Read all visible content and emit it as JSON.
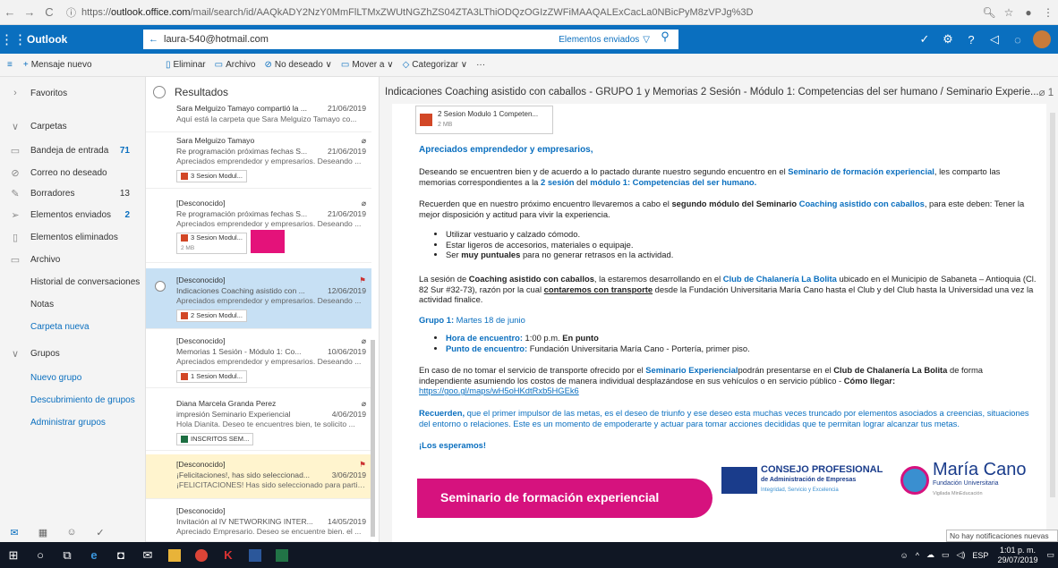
{
  "browser": {
    "url_prefix": "https://",
    "url_host": "outlook.office.com",
    "url_path": "/mail/search/id/AAQkADY2NzY0MmFlLTMxZWUtNGZhZS04ZTA3LThiODQzOGIzZWFiMAAQALExCacLa0NBicPyM8zVPJg%3D"
  },
  "topbar": {
    "app_name": "Outlook",
    "account": "laura-540@hotmail.com",
    "search_scope": "Elementos enviados"
  },
  "commands": {
    "new_message": "Mensaje nuevo",
    "delete": "Eliminar",
    "archive": "Archivo",
    "junk": "No deseado",
    "move": "Mover a",
    "categorize": "Categorizar",
    "more": "···"
  },
  "leftnav": {
    "favorites": "Favoritos",
    "folders": "Carpetas",
    "items": [
      {
        "label": "Bandeja de entrada",
        "count": "71"
      },
      {
        "label": "Correo no deseado",
        "count": ""
      },
      {
        "label": "Borradores",
        "count": "13"
      },
      {
        "label": "Elementos enviados",
        "count": "2"
      },
      {
        "label": "Elementos eliminados",
        "count": ""
      },
      {
        "label": "Archivo",
        "count": ""
      },
      {
        "label": "Historial de conversaciones",
        "count": ""
      },
      {
        "label": "Notas",
        "count": ""
      }
    ],
    "new_folder": "Carpeta nueva",
    "groups": "Grupos",
    "new_group": "Nuevo grupo",
    "discover_groups": "Descubrimiento de grupos",
    "manage_groups": "Administrar grupos"
  },
  "list": {
    "header": "Resultados",
    "messages": [
      {
        "from": "Sara Melguizo Tamayo compartió la ...",
        "subject": "",
        "date": "21/06/2019",
        "preview": "Aquí está la carpeta que Sara Melguizo Tamayo co...",
        "attachment": ""
      },
      {
        "from": "Sara Melguizo Tamayo",
        "subject": "Re programación próximas fechas S...",
        "date": "21/06/2019",
        "preview": "Apreciados emprendedor y empresarios. Deseando ...",
        "attachment": "3 Sesion Modul..."
      },
      {
        "from": "[Desconocido]",
        "subject": "Re programación próximas fechas S...",
        "date": "21/06/2019",
        "preview": "Apreciados emprendedor y empresarios. Deseando ...",
        "attachment": "3 Sesion Modul...",
        "attachment_size": "2 MB"
      },
      {
        "from": "[Desconocido]",
        "subject": "Indicaciones Coaching asistido con ...",
        "date": "12/06/2019",
        "preview": "Apreciados emprendedor y empresarios. Deseando ...",
        "attachment": "2 Sesion Modul..."
      },
      {
        "from": "[Desconocido]",
        "subject": "Memorias 1 Sesión - Módulo 1: Co...",
        "date": "10/06/2019",
        "preview": "Apreciados emprendedor y empresarios. Deseando ...",
        "attachment": "1 Sesion Modul..."
      },
      {
        "from": "Diana Marcela Granda Perez",
        "subject": "impresión Seminario Experiencial",
        "date": "4/06/2019",
        "preview": "Hola Dianita. Deseo te encuentres bien, te solicito ...",
        "attachment": "INSCRITOS SEM..."
      },
      {
        "from": "[Desconocido]",
        "subject": "¡Felicitaciones!, has sido seleccionad...",
        "date": "3/06/2019",
        "preview": "¡FELICITACIONES! Has sido seleccionado para partic...",
        "attachment": ""
      },
      {
        "from": "[Desconocido]",
        "subject": "Invitación al IV NETWORKING INTER...",
        "date": "14/05/2019",
        "preview": "Apreciado Empresario. Deseo se encuentre bien. el ...",
        "attachment": ""
      }
    ]
  },
  "reading": {
    "subject": "Indicaciones Coaching asistido con caballos - GRUPO 1 y Memorias 2 Sesión - Módulo 1: Competencias del ser humano / Seminario Experie...",
    "page_indicator": "1",
    "attachment_name": "2 Sesion Modulo 1 Competen...",
    "attachment_size": "2 MB",
    "greeting": "Apreciados emprendedor y empresarios,",
    "p1_a": "Deseando se encuentren bien y de acuerdo a lo pactado durante nuestro segundo encuentro en el ",
    "p1_b": "Seminario de formación experiencial",
    "p1_c": ", les comparto las memorias correspondientes a la ",
    "p1_d": "2 sesión",
    "p1_e": " del ",
    "p1_f": "módulo 1: Competencias del ser humano.",
    "p2_a": "Recuerden que en nuestro próximo encuentro llevaremos a cabo el ",
    "p2_b": "segundo módulo del Seminario",
    "p2_c": " ",
    "p2_d": "Coaching asistido con caballos",
    "p2_e": ", para este deben: Tener la mejor disposición y actitud para vivir la experiencia.",
    "bullet1": "Utilizar vestuario y calzado cómodo.",
    "bullet2": "Estar ligeros de accesorios, materiales o equipaje.",
    "bullet3_a": "Ser ",
    "bullet3_b": "muy puntuales",
    "bullet3_c": " para no generar retrasos en la actividad.",
    "p3_a": "La sesión de ",
    "p3_b": "Coaching asistido con caballos",
    "p3_c": ", la estaremos desarrollando en el ",
    "p3_d": "Club de Chalanería La Bolita",
    "p3_e": " ubicado en el Municipio de Sabaneta – Antioquia (Cl. 82 Sur #32-73), razón por la cual ",
    "p3_f": "contaremos con transporte",
    "p3_g": " desde la Fundación Universitaria María Cano hasta el Club y del Club hasta la Universidad una vez la actividad finalice.",
    "group_label": "Grupo 1:",
    "group_date": " Martes 18 de junio",
    "meet_label": "Hora de encuentro:",
    "meet_time": " 1:00 p.m. ",
    "meet_exact": "En punto",
    "point_label": "Punto de encuentro:",
    "point_value": " Fundación Universitaria María Cano -  Portería, primer piso.",
    "p4_a": "En caso de no tomar el servicio de transporte ofrecido por el ",
    "p4_b": "Seminario Experiencial",
    "p4_c": "podrán presentarse en el ",
    "p4_d": "Club de Chalanería La Bolita",
    "p4_e": " de forma independiente asumiendo los costos de manera individual desplazándose en sus vehículos o en servicio público - ",
    "p4_f": "Cómo llegar:",
    "p4_link": "https://goo.gl/maps/wH5oHKdtRxb5HGEk6",
    "p5_a": "Recuerden,",
    "p5_b": " que el primer impulsor de las metas, es el deseo de triunfo y ese deseo esta muchas veces truncado por elementos asociados a creencias, situaciones del entorno o relaciones. Este es un momento de empoderarte y actuar para tomar acciones decididas que te permitan lograr alcanzar tus metas.",
    "closing": "¡Los esperamos!",
    "banner_title": "Seminario de formación experiencial",
    "cp_title": "CONSEJO PROFESIONAL",
    "cp_sub": "de Administración de Empresas",
    "cp_tag": "Integridad, Servicio y Excelencia",
    "mc_name": "María Cano",
    "mc_sub": "Fundación Universitaria",
    "mc_tag": "Vigilada MinEducación"
  },
  "taskbar": {
    "notification": "No hay notificaciones nuevas",
    "lang": "ESP",
    "time": "1:01 p. m.",
    "date": "29/07/2019"
  },
  "colors": {
    "brand": "#0a6fbf",
    "selected": "#c7e0f4",
    "flagged": "#fff4ce",
    "accent_pink": "#d6127e"
  }
}
